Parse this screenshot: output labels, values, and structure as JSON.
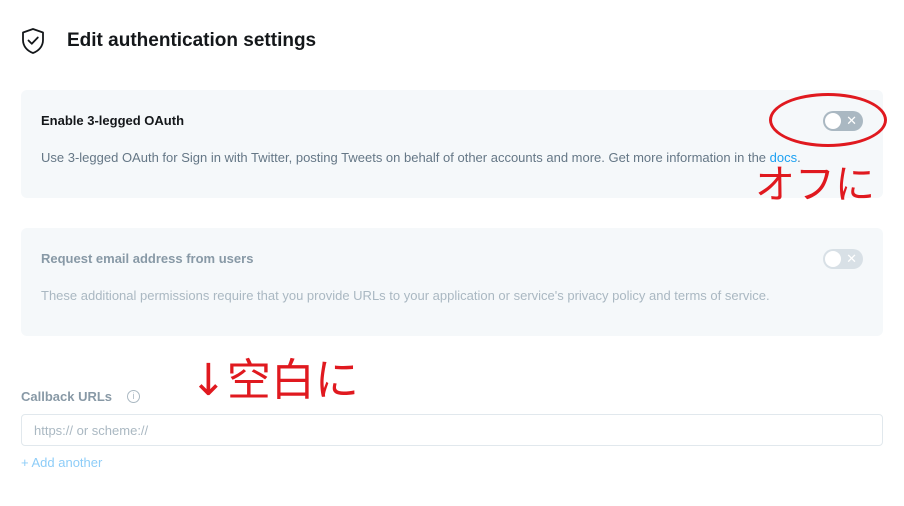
{
  "header": {
    "icon": "shield-check-icon",
    "title": "Edit authentication settings"
  },
  "oauth": {
    "title": "Enable 3-legged OAuth",
    "description": "Use 3-legged OAuth for Sign in with Twitter, posting Tweets on behalf of other accounts and more. Get more information in the ",
    "link_text": "docs",
    "period": ".",
    "toggle_state": "off",
    "toggle_glyph": "✕"
  },
  "email": {
    "title": "Request email address from users",
    "description": "These additional permissions require that you provide URLs to your application or service's privacy policy and terms of service.",
    "toggle_state": "off",
    "toggle_glyph": "✕"
  },
  "callback": {
    "label": "Callback URLs",
    "info_glyph": "i",
    "placeholder": "https:// or scheme://",
    "value": "",
    "add_another": "+ Add another"
  },
  "annotations": {
    "off_note": "オフに",
    "blank_note": "↓空白に",
    "color": "#e0191f"
  }
}
